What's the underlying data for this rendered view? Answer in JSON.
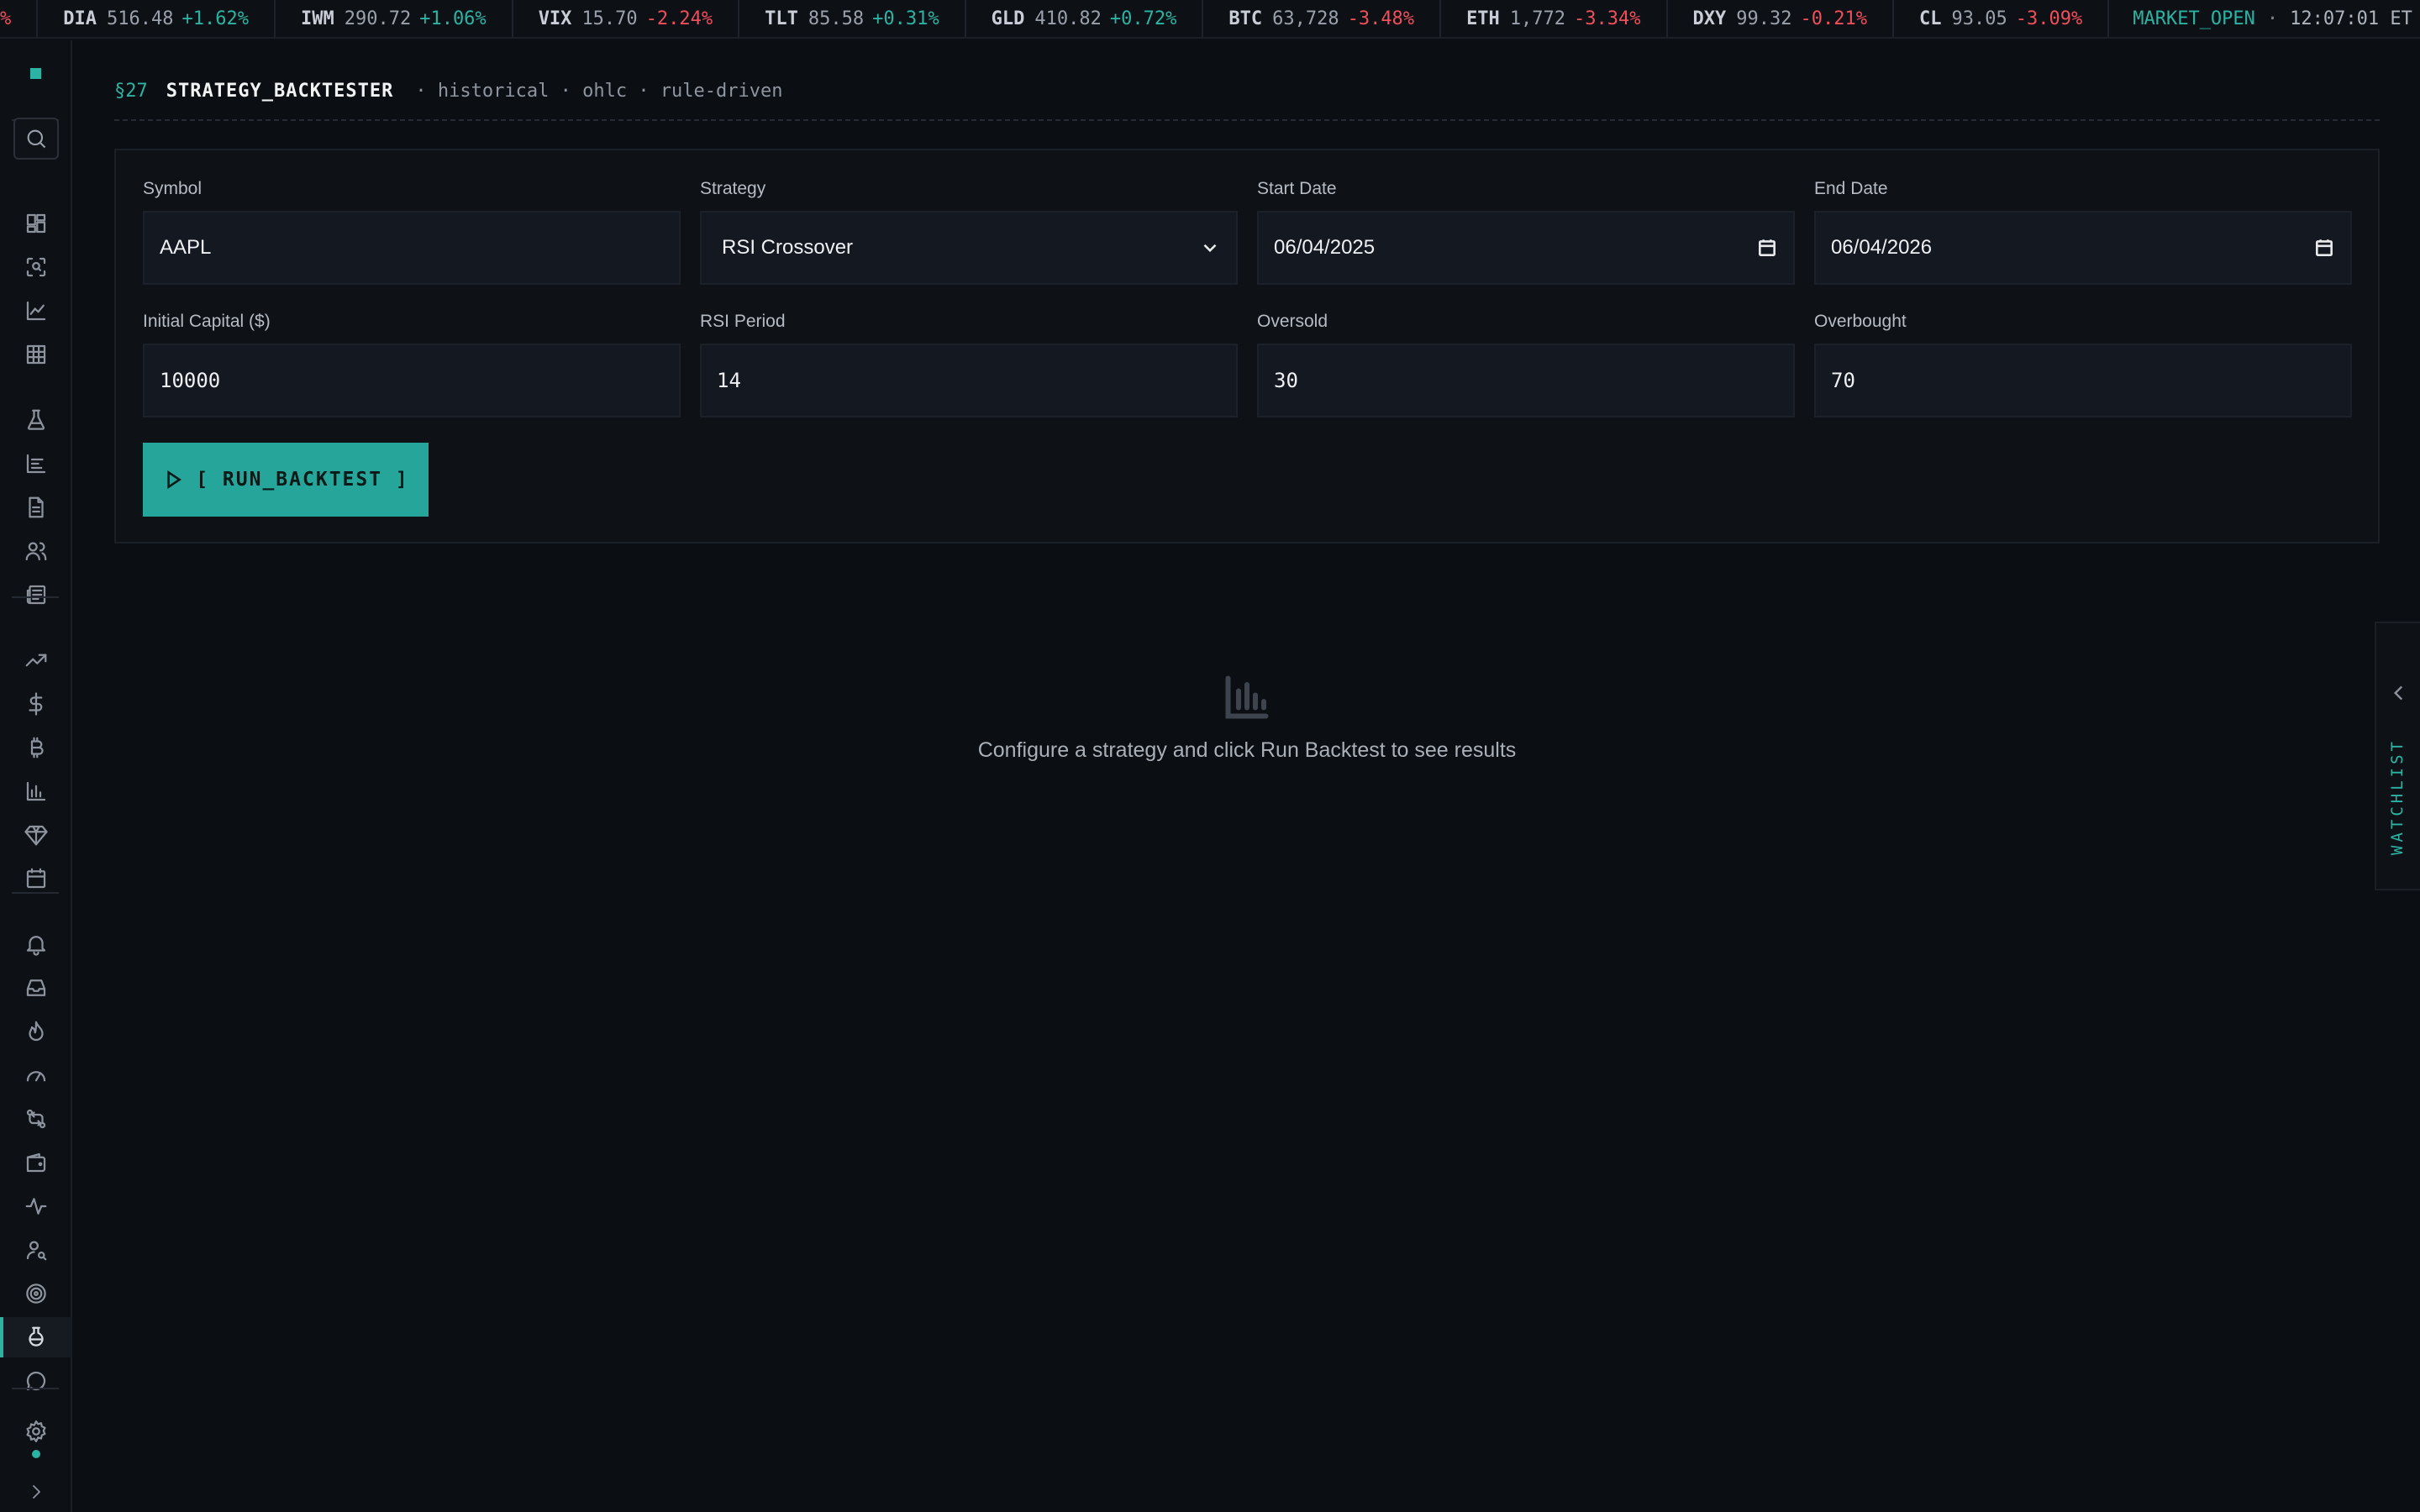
{
  "ticker": {
    "lead_fragment": "%",
    "items": [
      {
        "symbol": "DIA",
        "price": "516.48",
        "change": "+1.62%",
        "direction": "up"
      },
      {
        "symbol": "IWM",
        "price": "290.72",
        "change": "+1.06%",
        "direction": "up"
      },
      {
        "symbol": "VIX",
        "price": "15.70",
        "change": "-2.24%",
        "direction": "down"
      },
      {
        "symbol": "TLT",
        "price": "85.58",
        "change": "+0.31%",
        "direction": "up"
      },
      {
        "symbol": "GLD",
        "price": "410.82",
        "change": "+0.72%",
        "direction": "up"
      },
      {
        "symbol": "BTC",
        "price": "63,728",
        "change": "-3.48%",
        "direction": "down"
      },
      {
        "symbol": "ETH",
        "price": "1,772",
        "change": "-3.34%",
        "direction": "down"
      },
      {
        "symbol": "DXY",
        "price": "99.32",
        "change": "-0.21%",
        "direction": "down"
      },
      {
        "symbol": "CL",
        "price": "93.05",
        "change": "-3.09%",
        "direction": "down"
      }
    ],
    "market_status": "MARKET_OPEN",
    "separator": "·",
    "clock": "12:07:01 ET"
  },
  "sidebar": {
    "icons": [
      "dashboard-icon",
      "scan-icon",
      "line-chart-icon",
      "grid-icon",
      "flask-icon",
      "bar-chart-icon",
      "document-icon",
      "users-icon",
      "newspaper-icon",
      "trending-up-icon",
      "dollar-icon",
      "bitcoin-icon",
      "column-chart-icon",
      "gem-icon",
      "calendar-icon",
      "bell-icon",
      "inbox-icon",
      "flame-icon",
      "gauge-icon",
      "swap-icon",
      "wallet-icon",
      "pulse-icon",
      "user-search-icon",
      "target-icon",
      "beaker-icon",
      "chat-icon",
      "settings-icon"
    ],
    "active": "beaker-icon"
  },
  "header": {
    "section": "§27",
    "title": "STRATEGY_BACKTESTER",
    "meta": "· historical · ohlc · rule-driven"
  },
  "form": {
    "symbol": {
      "label": "Symbol",
      "value": "AAPL"
    },
    "strategy": {
      "label": "Strategy",
      "value": "RSI Crossover"
    },
    "start_date": {
      "label": "Start Date",
      "value": "06/04/2025"
    },
    "end_date": {
      "label": "End Date",
      "value": "06/04/2026"
    },
    "initial_capital": {
      "label": "Initial Capital ($)",
      "value": "10000"
    },
    "rsi_period": {
      "label": "RSI Period",
      "value": "14"
    },
    "oversold": {
      "label": "Oversold",
      "value": "30"
    },
    "overbought": {
      "label": "Overbought",
      "value": "70"
    },
    "run_button": "[ RUN_BACKTEST ]"
  },
  "empty_state": {
    "icon": "bar-chart-icon",
    "message": "Configure a strategy and click Run Backtest to see results"
  },
  "watchlist": {
    "label": "WATCHLIST"
  },
  "colors": {
    "accent": "#2bb3a3",
    "up": "#2bb3a3",
    "down": "#ef4f5a",
    "background": "#0b0e12",
    "button": "#26a69a"
  }
}
